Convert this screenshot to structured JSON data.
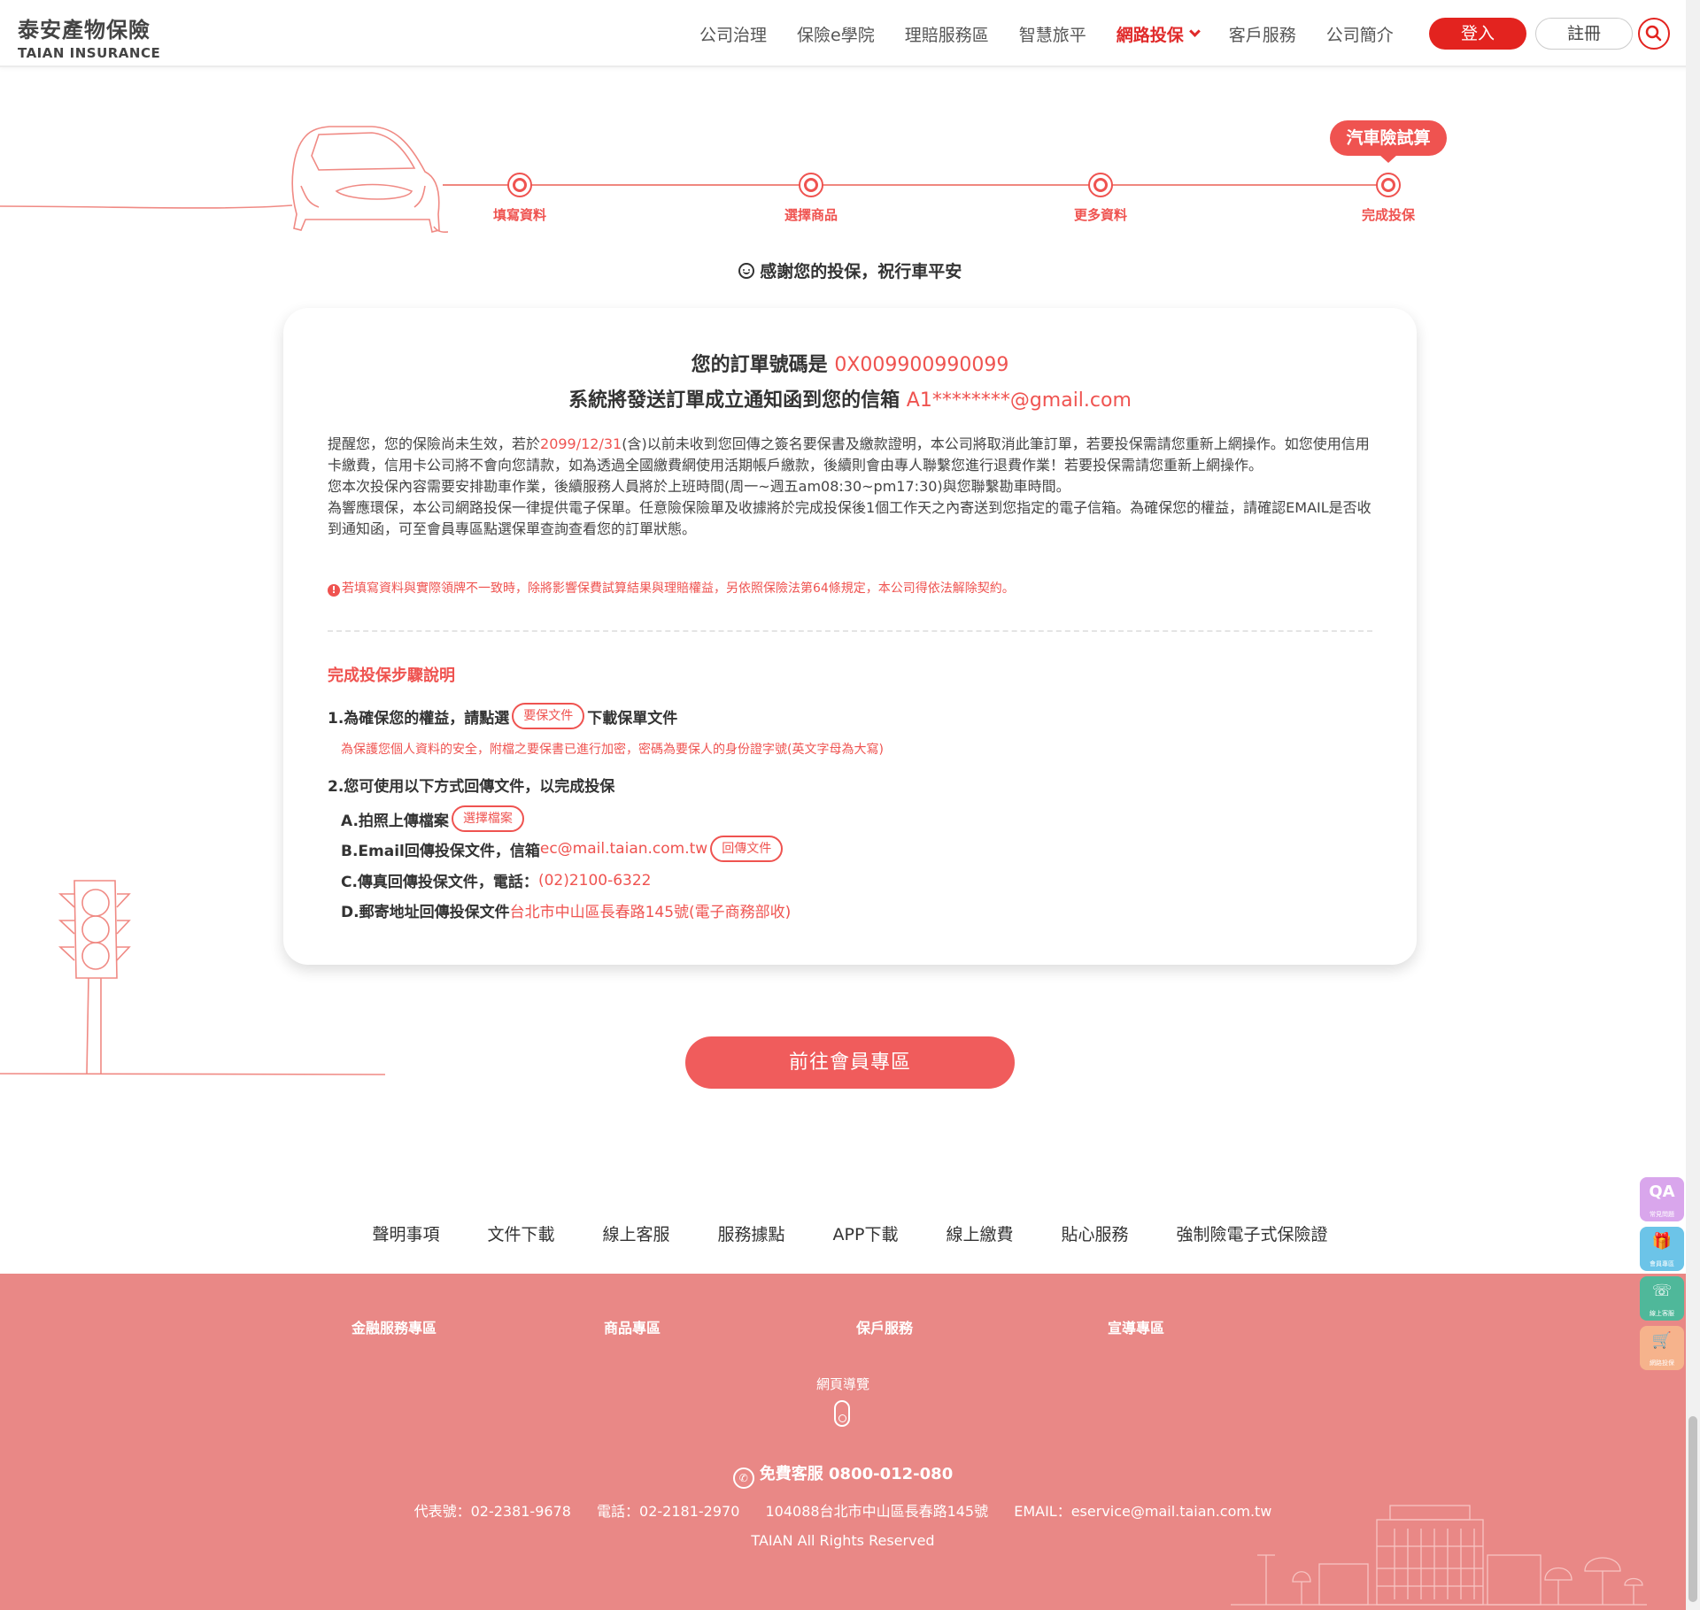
{
  "header": {
    "logo_cn": "泰安產物保險",
    "logo_en": "TAIAN INSURANCE",
    "nav": [
      "公司治理",
      "保險e學院",
      "理賠服務區",
      "智慧旅平",
      "網路投保",
      "客戶服務",
      "公司簡介"
    ],
    "active_nav": "網路投保",
    "login_label": "登入",
    "register_label": "註冊",
    "accent": "#e3231f"
  },
  "progress": {
    "badge": "汽車險試算",
    "steps": [
      "填寫資料",
      "選擇商品",
      "更多資料",
      "完成投保"
    ],
    "color": "#ef5350"
  },
  "thanks": "感謝您的投保，祝行車平安",
  "order": {
    "number_label": "您的訂單號碼是",
    "number": "0X009900990099",
    "email_label": "系統將發送訂單成立通知函到您的信箱",
    "email": "A1********@gmail.com"
  },
  "notice": {
    "p1_pre": "提醒您，您的保險尚未生效，若於",
    "p1_date": "2099/12/31",
    "p1_post": "(含)以前未收到您回傳之簽名要保書及繳款證明，本公司將取消此筆訂單，若要投保需請您重新上網操作。如您使用信用卡繳費，信用卡公司將不會向您請款，如為透過全國繳費網使用活期帳戶繳款，後續則會由專人聯繫您進行退費作業！若要投保需請您重新上網操作。",
    "p2": "您本次投保內容需要安排勘車作業，後續服務人員將於上班時間(周一~週五am08:30~pm17:30)與您聯繫勘車時間。",
    "p3": "為響應環保，本公司網路投保一律提供電子保單。任意險保險單及收據將於完成投保後1個工作天之內寄送到您指定的電子信箱。為確保您的權益，請確認EMAIL是否收到通知函，可至會員專區點選保單查詢查看您的訂單狀態。",
    "warning": "若填寫資料與實際領牌不一致時，除將影響保費試算結果與理賠權益，另依照保險法第64條規定，本公司得依法解除契約。"
  },
  "steps_info": {
    "title": "完成投保步驟說明",
    "step1_pre": "1.為確保您的權益，請點選",
    "step1_btn": "要保文件",
    "step1_post": "下載保單文件",
    "step1_note": "為保護您個人資料的安全，附檔之要保書已進行加密，密碼為要保人的身份證字號(英文字母為大寫)",
    "step2": "2.您可使用以下方式回傳文件，以完成投保",
    "a_label": "A.拍照上傳檔案",
    "a_btn": "選擇檔案",
    "b_label": "B.Email回傳投保文件，信箱",
    "b_email": "ec@mail.taian.com.tw",
    "b_btn": "回傳文件",
    "c_label": "C.傳真回傳投保文件，電話：",
    "c_phone": "(02)2100-6322",
    "d_label": "D.郵寄地址回傳投保文件",
    "d_addr": "台北市中山區長春路145號(電子商務部收)"
  },
  "member_button": "前往會員專區",
  "footer_links": [
    "聲明事項",
    "文件下載",
    "線上客服",
    "服務據點",
    "APP下載",
    "線上繳費",
    "貼心服務",
    "強制險電子式保險證"
  ],
  "footer": {
    "categories": [
      "金融服務專區",
      "商品專區",
      "保戶服務",
      "宣導專區"
    ],
    "sitemap": "網頁導覽",
    "hotline": "免費客服 0800-012-080",
    "rep": "代表號：02-2381-9678",
    "tel": "電話：02-2181-2970",
    "address": "104088台北市中山區長春路145號",
    "email": "EMAIL：eservice@mail.taian.com.tw",
    "rights": "TAIAN All Rights Reserved",
    "bg": "#e98886"
  },
  "floaters": [
    {
      "icon": "QA",
      "label": "常見問題",
      "color": "#d9a6ec"
    },
    {
      "icon": "🎁",
      "label": "會員專區",
      "color": "#6cc4e8"
    },
    {
      "icon": "☏",
      "label": "線上客服",
      "color": "#4fb89a"
    },
    {
      "icon": "🛒",
      "label": "網路投保",
      "color": "#f6b38c"
    }
  ]
}
